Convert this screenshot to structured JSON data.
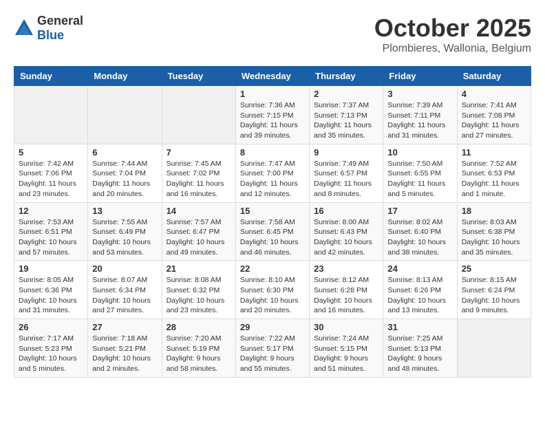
{
  "header": {
    "logo": {
      "general": "General",
      "blue": "Blue"
    },
    "title": "October 2025",
    "location": "Plombieres, Wallonia, Belgium"
  },
  "calendar": {
    "days_of_week": [
      "Sunday",
      "Monday",
      "Tuesday",
      "Wednesday",
      "Thursday",
      "Friday",
      "Saturday"
    ],
    "weeks": [
      [
        {
          "day": "",
          "info": ""
        },
        {
          "day": "",
          "info": ""
        },
        {
          "day": "",
          "info": ""
        },
        {
          "day": "1",
          "info": "Sunrise: 7:36 AM\nSunset: 7:15 PM\nDaylight: 11 hours\nand 39 minutes."
        },
        {
          "day": "2",
          "info": "Sunrise: 7:37 AM\nSunset: 7:13 PM\nDaylight: 11 hours\nand 35 minutes."
        },
        {
          "day": "3",
          "info": "Sunrise: 7:39 AM\nSunset: 7:11 PM\nDaylight: 11 hours\nand 31 minutes."
        },
        {
          "day": "4",
          "info": "Sunrise: 7:41 AM\nSunset: 7:08 PM\nDaylight: 11 hours\nand 27 minutes."
        }
      ],
      [
        {
          "day": "5",
          "info": "Sunrise: 7:42 AM\nSunset: 7:06 PM\nDaylight: 11 hours\nand 23 minutes."
        },
        {
          "day": "6",
          "info": "Sunrise: 7:44 AM\nSunset: 7:04 PM\nDaylight: 11 hours\nand 20 minutes."
        },
        {
          "day": "7",
          "info": "Sunrise: 7:45 AM\nSunset: 7:02 PM\nDaylight: 11 hours\nand 16 minutes."
        },
        {
          "day": "8",
          "info": "Sunrise: 7:47 AM\nSunset: 7:00 PM\nDaylight: 11 hours\nand 12 minutes."
        },
        {
          "day": "9",
          "info": "Sunrise: 7:49 AM\nSunset: 6:57 PM\nDaylight: 11 hours\nand 8 minutes."
        },
        {
          "day": "10",
          "info": "Sunrise: 7:50 AM\nSunset: 6:55 PM\nDaylight: 11 hours\nand 5 minutes."
        },
        {
          "day": "11",
          "info": "Sunrise: 7:52 AM\nSunset: 6:53 PM\nDaylight: 11 hours\nand 1 minute."
        }
      ],
      [
        {
          "day": "12",
          "info": "Sunrise: 7:53 AM\nSunset: 6:51 PM\nDaylight: 10 hours\nand 57 minutes."
        },
        {
          "day": "13",
          "info": "Sunrise: 7:55 AM\nSunset: 6:49 PM\nDaylight: 10 hours\nand 53 minutes."
        },
        {
          "day": "14",
          "info": "Sunrise: 7:57 AM\nSunset: 6:47 PM\nDaylight: 10 hours\nand 49 minutes."
        },
        {
          "day": "15",
          "info": "Sunrise: 7:58 AM\nSunset: 6:45 PM\nDaylight: 10 hours\nand 46 minutes."
        },
        {
          "day": "16",
          "info": "Sunrise: 8:00 AM\nSunset: 6:43 PM\nDaylight: 10 hours\nand 42 minutes."
        },
        {
          "day": "17",
          "info": "Sunrise: 8:02 AM\nSunset: 6:40 PM\nDaylight: 10 hours\nand 38 minutes."
        },
        {
          "day": "18",
          "info": "Sunrise: 8:03 AM\nSunset: 6:38 PM\nDaylight: 10 hours\nand 35 minutes."
        }
      ],
      [
        {
          "day": "19",
          "info": "Sunrise: 8:05 AM\nSunset: 6:36 PM\nDaylight: 10 hours\nand 31 minutes."
        },
        {
          "day": "20",
          "info": "Sunrise: 8:07 AM\nSunset: 6:34 PM\nDaylight: 10 hours\nand 27 minutes."
        },
        {
          "day": "21",
          "info": "Sunrise: 8:08 AM\nSunset: 6:32 PM\nDaylight: 10 hours\nand 23 minutes."
        },
        {
          "day": "22",
          "info": "Sunrise: 8:10 AM\nSunset: 6:30 PM\nDaylight: 10 hours\nand 20 minutes."
        },
        {
          "day": "23",
          "info": "Sunrise: 8:12 AM\nSunset: 6:28 PM\nDaylight: 10 hours\nand 16 minutes."
        },
        {
          "day": "24",
          "info": "Sunrise: 8:13 AM\nSunset: 6:26 PM\nDaylight: 10 hours\nand 13 minutes."
        },
        {
          "day": "25",
          "info": "Sunrise: 8:15 AM\nSunset: 6:24 PM\nDaylight: 10 hours\nand 9 minutes."
        }
      ],
      [
        {
          "day": "26",
          "info": "Sunrise: 7:17 AM\nSunset: 5:23 PM\nDaylight: 10 hours\nand 5 minutes."
        },
        {
          "day": "27",
          "info": "Sunrise: 7:18 AM\nSunset: 5:21 PM\nDaylight: 10 hours\nand 2 minutes."
        },
        {
          "day": "28",
          "info": "Sunrise: 7:20 AM\nSunset: 5:19 PM\nDaylight: 9 hours\nand 58 minutes."
        },
        {
          "day": "29",
          "info": "Sunrise: 7:22 AM\nSunset: 5:17 PM\nDaylight: 9 hours\nand 55 minutes."
        },
        {
          "day": "30",
          "info": "Sunrise: 7:24 AM\nSunset: 5:15 PM\nDaylight: 9 hours\nand 51 minutes."
        },
        {
          "day": "31",
          "info": "Sunrise: 7:25 AM\nSunset: 5:13 PM\nDaylight: 9 hours\nand 48 minutes."
        },
        {
          "day": "",
          "info": ""
        }
      ]
    ]
  }
}
